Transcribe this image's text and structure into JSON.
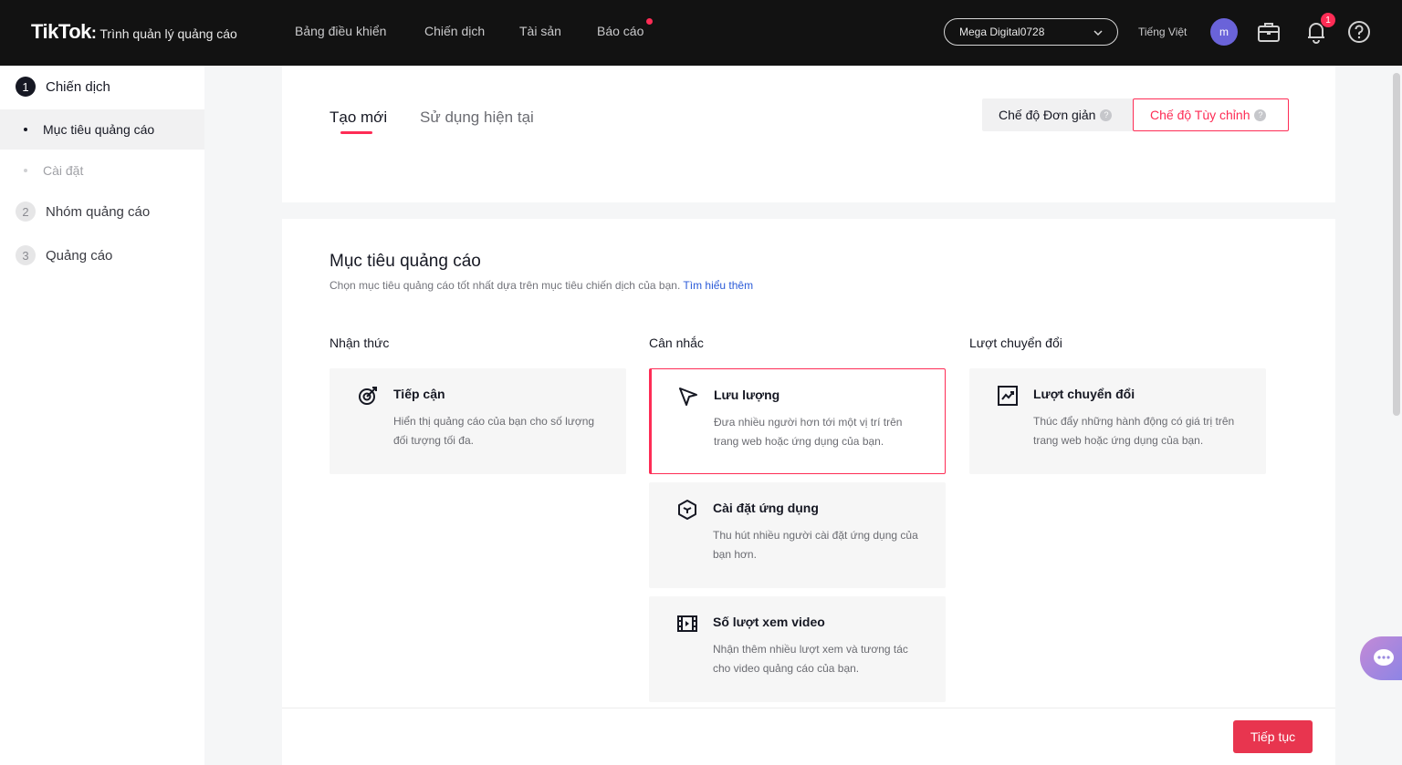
{
  "header": {
    "brand": "TikTok",
    "brand_separator": ":",
    "brand_sub": "Trình quản lý quảng cáo",
    "nav": [
      "Bảng điều khiển",
      "Chiến dịch",
      "Tài sản",
      "Báo cáo"
    ],
    "account": "Mega Digital0728",
    "language": "Tiếng Việt",
    "avatar_letter": "m",
    "notification_count": "1"
  },
  "sidebar": {
    "step1": {
      "num": "1",
      "label": "Chiến dịch"
    },
    "sub_items": [
      "Mục tiêu quảng cáo",
      "Cài đặt"
    ],
    "step2": {
      "num": "2",
      "label": "Nhóm quảng cáo"
    },
    "step3": {
      "num": "3",
      "label": "Quảng cáo"
    }
  },
  "tabs": {
    "create_new": "Tạo mới",
    "use_existing": "Sử dụng hiện tại"
  },
  "modes": {
    "simple": "Chế độ Đơn giản",
    "custom": "Chế độ Tùy chỉnh"
  },
  "objective": {
    "title": "Mục tiêu quảng cáo",
    "desc": "Chọn mục tiêu quảng cáo tốt nhất dựa trên mục tiêu chiến dịch của bạn.",
    "learn_more": "Tìm hiểu thêm",
    "columns": [
      "Nhận thức",
      "Cân nhắc",
      "Lượt chuyển đổi"
    ],
    "reach": {
      "title": "Tiếp cận",
      "desc": "Hiển thị quảng cáo của bạn cho số lượng đối tượng tối đa."
    },
    "traffic": {
      "title": "Lưu lượng",
      "desc": "Đưa nhiều người hơn tới một vị trí trên trang web hoặc ứng dụng của bạn."
    },
    "app_install": {
      "title": "Cài đặt ứng dụng",
      "desc": "Thu hút nhiều người cài đặt ứng dụng của bạn hơn."
    },
    "video_views": {
      "title": "Số lượt xem video",
      "desc": "Nhận thêm nhiều lượt xem và tương tác cho video quảng cáo của bạn."
    },
    "conversions": {
      "title": "Lượt chuyển đổi",
      "desc": "Thúc đẩy những hành động có giá trị trên trang web hoặc ứng dụng của bạn."
    }
  },
  "footer": {
    "continue": "Tiếp tục"
  },
  "colors": {
    "accent": "#fe2c55",
    "topbar": "#121212",
    "link": "#2b5bd8"
  }
}
